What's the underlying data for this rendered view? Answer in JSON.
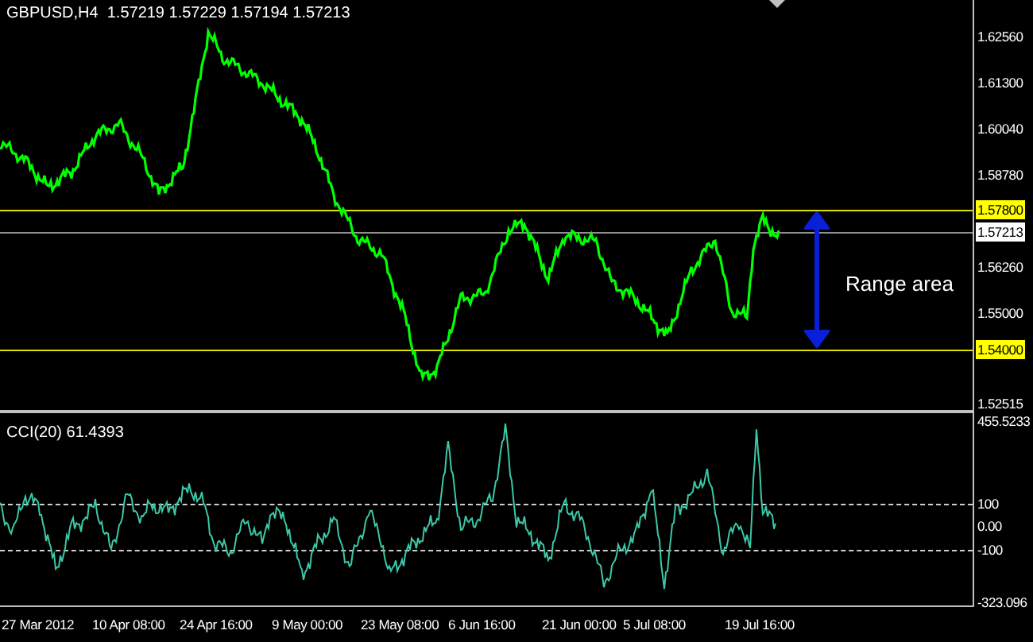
{
  "price_pane": {
    "header": "GBPUSD,H4  1.57219 1.57229 1.57194 1.57213",
    "axis_labels": [
      {
        "text": "1.62560",
        "kind": "tick"
      },
      {
        "text": "1.61300",
        "kind": "tick"
      },
      {
        "text": "1.60040",
        "kind": "tick"
      },
      {
        "text": "1.58780",
        "kind": "tick"
      },
      {
        "text": "1.57800",
        "kind": "level"
      },
      {
        "text": "1.57213",
        "kind": "bid"
      },
      {
        "text": "1.56260",
        "kind": "tick"
      },
      {
        "text": "1.55000",
        "kind": "tick"
      },
      {
        "text": "1.54000",
        "kind": "level"
      },
      {
        "text": "1.52515",
        "kind": "tick"
      }
    ],
    "annotation": "Range area"
  },
  "indicator_pane": {
    "header": "CCI(20) 61.4393",
    "axis_labels": [
      {
        "text": "455.5233",
        "kind": "tick"
      },
      {
        "text": "100",
        "kind": "level"
      },
      {
        "text": "0.00",
        "kind": "tick"
      },
      {
        "text": "-100",
        "kind": "level"
      },
      {
        "text": "-323.096",
        "kind": "tick"
      }
    ]
  },
  "time_axis": [
    "27 Mar 2012",
    "10 Apr 08:00",
    "24 Apr 16:00",
    "9 May 00:00",
    "23 May 08:00",
    "6 Jun 16:00",
    "21 Jun 00:00",
    "5 Jul 08:00",
    "19 Jul 16:00"
  ]
}
